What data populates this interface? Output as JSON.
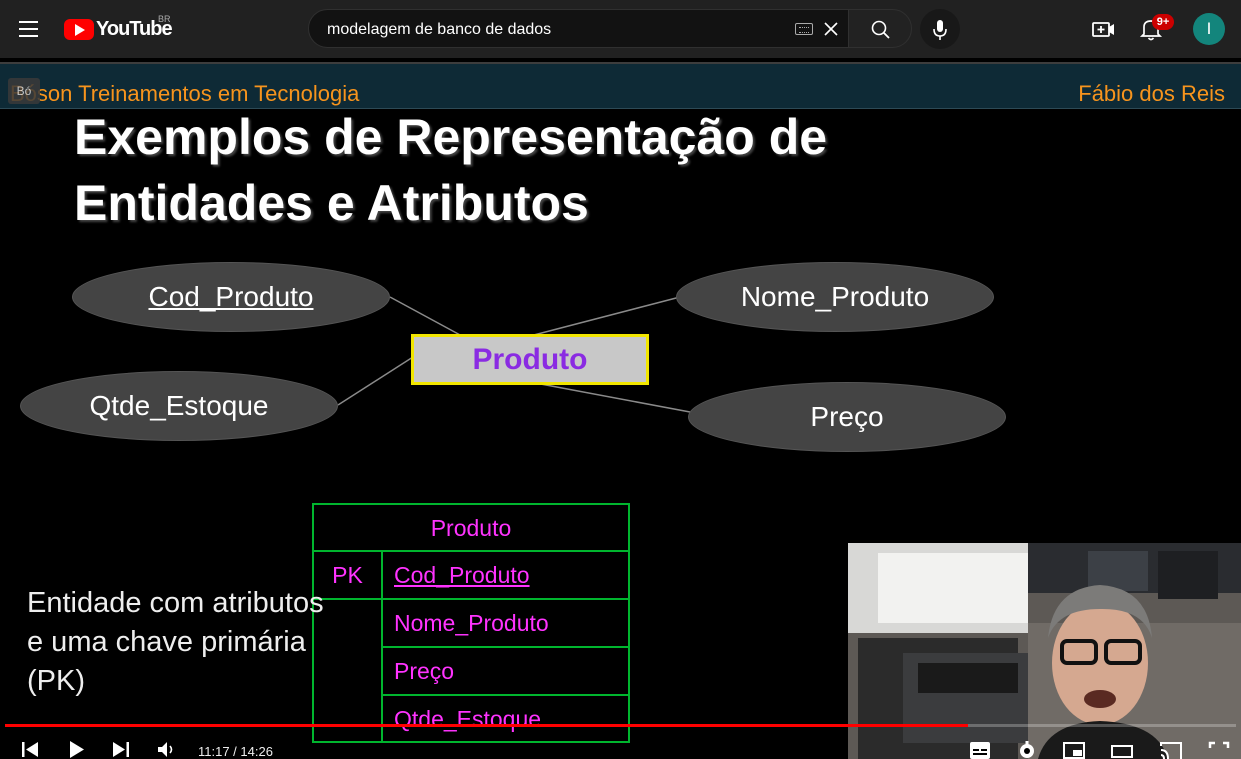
{
  "header": {
    "logo_text": "YouTube",
    "country": "BR",
    "search_value": "modelagem de banco de dados",
    "notifications_badge": "9+",
    "avatar_letter": "I",
    "icons": {
      "menu": "menu-icon",
      "keyboard": "keyboard-icon",
      "clear": "close-icon",
      "search": "search-icon",
      "mic": "mic-icon",
      "create": "create-video-icon",
      "notifications": "bell-icon"
    },
    "colors": {
      "brand": "#ff0000",
      "badge": "#cc0000",
      "avatar": "#13857c"
    }
  },
  "video": {
    "badge_text": "Bó",
    "header_left": "Bóson Treinamentos em Tecnologia",
    "header_right": "Fábio dos Reis",
    "title_line1": "Exemplos de Representação de",
    "title_line2": "Entidades e Atributos",
    "entity": "Produto",
    "attributes": {
      "cod_produto": "Cod_Produto",
      "nome_produto": "Nome_Produto",
      "qtde_estoque": "Qtde_Estoque",
      "preco": "Preço"
    },
    "table": {
      "title": "Produto",
      "pk_label": "PK",
      "rows": [
        "Cod_Produto",
        "Nome_Produto",
        "Preço",
        "Qtde_Estoque"
      ]
    },
    "caption": "Entidade com atributos e uma chave primária (PK)",
    "colors": {
      "header_text": "#f7941d",
      "entity_text": "#8a2be2",
      "entity_border": "#f2e600",
      "table_border": "#00b52e",
      "table_text": "#ff33ff"
    }
  },
  "player": {
    "current_time": "11:17",
    "duration": "14:26",
    "time_display": "11:17 / 14:26",
    "progress": 0.782,
    "controls": [
      "previous-icon",
      "play-icon",
      "next-icon",
      "volume-icon",
      "subtitles-icon",
      "settings-icon",
      "miniplayer-icon",
      "theater-icon",
      "cast-icon",
      "fullscreen-icon"
    ]
  }
}
